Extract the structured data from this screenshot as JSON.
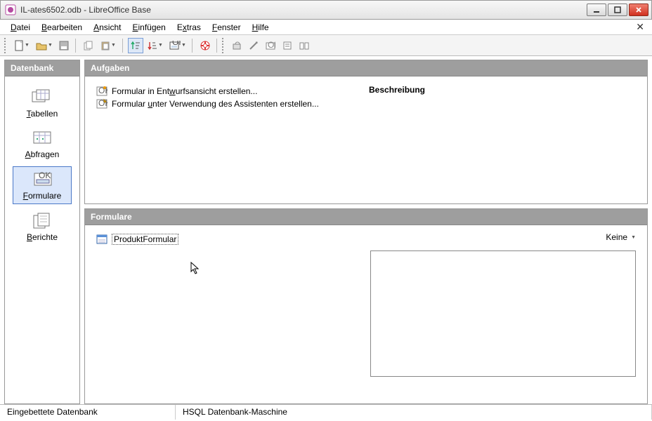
{
  "window": {
    "title": "IL-ates6502.odb - LibreOffice Base"
  },
  "menu": {
    "items": [
      {
        "html": "<u>D</u>atei"
      },
      {
        "html": "<u>B</u>earbeiten"
      },
      {
        "html": "<u>A</u>nsicht"
      },
      {
        "html": "<u>E</u>infügen"
      },
      {
        "html": "E<u>x</u>tras"
      },
      {
        "html": "<u>F</u>enster"
      },
      {
        "html": "<u>H</u>ilfe"
      }
    ]
  },
  "sidebar": {
    "header": "Datenbank",
    "items": [
      {
        "key": "tables",
        "label_html": "<u>T</u>abellen",
        "selected": false
      },
      {
        "key": "queries",
        "label_html": "<u>A</u>bfragen",
        "selected": false
      },
      {
        "key": "forms",
        "label_html": "<u>F</u>ormulare",
        "selected": true
      },
      {
        "key": "reports",
        "label_html": "<u>B</u>erichte",
        "selected": false
      }
    ]
  },
  "tasks": {
    "header": "Aufgaben",
    "items": [
      {
        "html": "Formular in Ent<u>w</u>urfsansicht erstellen..."
      },
      {
        "html": "Formular <u>u</u>nter Verwendung des Assistenten erstellen..."
      }
    ],
    "description_header": "Beschreibung"
  },
  "forms": {
    "header": "Formulare",
    "items": [
      "ProduktFormular"
    ],
    "view_label": "Keine"
  },
  "statusbar": {
    "cell1": "Eingebettete Datenbank",
    "cell2": "HSQL Datenbank-Maschine"
  }
}
